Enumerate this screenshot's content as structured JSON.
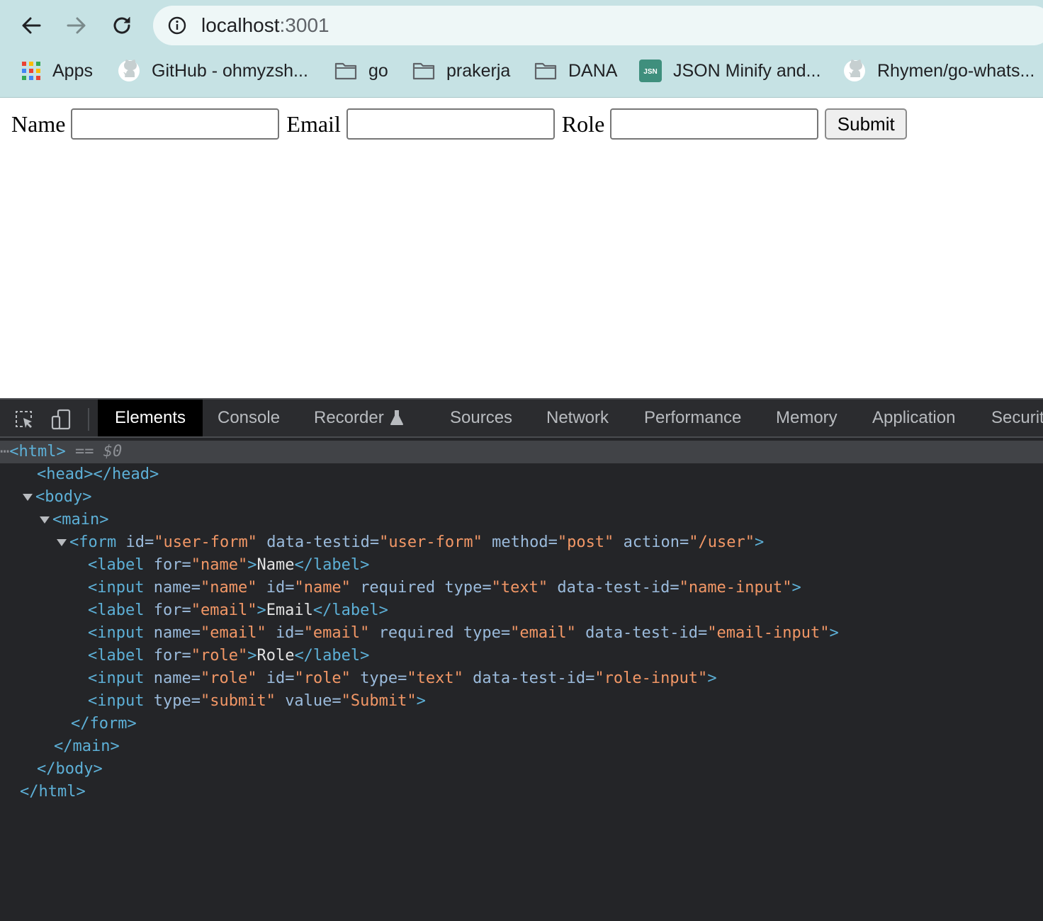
{
  "browser": {
    "url_host": "localhost",
    "url_port": ":3001",
    "bookmarks": [
      {
        "label": "Apps",
        "icon": "apps-grid-icon"
      },
      {
        "label": "GitHub - ohmyzsh...",
        "icon": "github-icon"
      },
      {
        "label": "go",
        "icon": "folder-icon"
      },
      {
        "label": "prakerja",
        "icon": "folder-icon"
      },
      {
        "label": "DANA",
        "icon": "folder-icon"
      },
      {
        "label": "JSON Minify and...",
        "icon": "json-icon"
      },
      {
        "label": "Rhymen/go-whats...",
        "icon": "github-icon"
      }
    ],
    "json_icon_text": "JSN"
  },
  "form": {
    "name_label": "Name",
    "email_label": "Email",
    "role_label": "Role",
    "submit_value": "Submit"
  },
  "devtools": {
    "tabs": [
      "Elements",
      "Console",
      "Recorder",
      "Sources",
      "Network",
      "Performance",
      "Memory",
      "Application",
      "Securit"
    ],
    "active_tab": "Elements",
    "dom": {
      "selected_suffix": "== $0",
      "lines": {
        "html_open": "<html>",
        "head": "<head></head>",
        "body_open": "<body>",
        "main_open": "<main>",
        "form_tag": "<form",
        "form_attrs": [
          {
            "name": "id",
            "value": "\"user-form\""
          },
          {
            "name": "data-testid",
            "value": "\"user-form\""
          },
          {
            "name": "method",
            "value": "\"post\""
          },
          {
            "name": "action",
            "value": "\"/user\""
          }
        ],
        "label_name": {
          "for": "\"name\"",
          "text": "Name"
        },
        "input_name": [
          {
            "name": "name",
            "value": "\"name\""
          },
          {
            "name": "id",
            "value": "\"name\""
          },
          {
            "name": "required",
            "value": ""
          },
          {
            "name": "type",
            "value": "\"text\""
          },
          {
            "name": "data-test-id",
            "value": "\"name-input\""
          }
        ],
        "label_email": {
          "for": "\"email\"",
          "text": "Email"
        },
        "input_email": [
          {
            "name": "name",
            "value": "\"email\""
          },
          {
            "name": "id",
            "value": "\"email\""
          },
          {
            "name": "required",
            "value": ""
          },
          {
            "name": "type",
            "value": "\"email\""
          },
          {
            "name": "data-test-id",
            "value": "\"email-input\""
          }
        ],
        "label_role": {
          "for": "\"role\"",
          "text": "Role"
        },
        "input_role": [
          {
            "name": "name",
            "value": "\"role\""
          },
          {
            "name": "id",
            "value": "\"role\""
          },
          {
            "name": "type",
            "value": "\"text\""
          },
          {
            "name": "data-test-id",
            "value": "\"role-input\""
          }
        ],
        "input_submit": [
          {
            "name": "type",
            "value": "\"submit\""
          },
          {
            "name": "value",
            "value": "\"Submit\""
          }
        ],
        "form_close": "</form>",
        "main_close": "</main>",
        "body_close": "</body>",
        "html_close": "</html>"
      }
    }
  },
  "colors": {
    "chrome_bg": "#c6e2e4",
    "devtools_bg": "#242528",
    "tag": "#5db0d7",
    "attr_name": "#9bbbdc",
    "attr_value": "#f29766"
  }
}
